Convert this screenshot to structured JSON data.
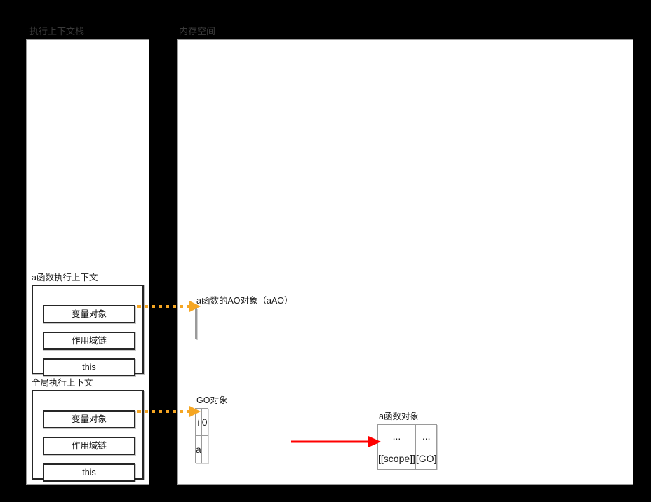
{
  "diagram": {
    "title_left": "执行上下文栈",
    "title_right": "内存空间",
    "colors": {
      "background": "#000000",
      "panel_fill": "#ffffff",
      "panel_border": "#9a9a9a",
      "box_border": "#262626",
      "table_border": "#9a9a9a",
      "arrow_dotted": "#f5a623",
      "arrow_solid": "#ff0000",
      "label_on_black": "#3a3a3a",
      "text": "#1a1a1a"
    }
  },
  "stack": {
    "label": "执行上下文栈",
    "contexts": [
      {
        "title": "a函数执行上下文",
        "rows": [
          "变量对象",
          "作用域链",
          "this"
        ]
      },
      {
        "title": "全局执行上下文",
        "rows": [
          "变量对象",
          "作用域链",
          "this"
        ]
      }
    ]
  },
  "memory": {
    "label": "内存空间",
    "objects": [
      {
        "title": "a函数的AO对象（aAO）",
        "rows": [
          [
            "",
            ""
          ]
        ]
      },
      {
        "title": "GO对象",
        "rows": [
          [
            "i",
            "0"
          ],
          [
            "a",
            ""
          ]
        ]
      },
      {
        "title": "a函数对象",
        "rows": [
          [
            "...",
            "..."
          ],
          [
            "[[scope]]",
            "[GO]"
          ]
        ]
      }
    ]
  },
  "arrows": [
    {
      "name": "a-context-variable-object-to-aAO",
      "style": "dotted",
      "color": "#f5a623",
      "from": "a函数执行上下文 / 变量对象",
      "to": "a函数的AO对象（aAO）"
    },
    {
      "name": "global-context-variable-object-to-GO",
      "style": "dotted",
      "color": "#f5a623",
      "from": "全局执行上下文 / 变量对象",
      "to": "GO对象"
    },
    {
      "name": "GO-a-value-to-function-object",
      "style": "solid",
      "color": "#ff0000",
      "from": "GO对象 / a",
      "to": "a函数对象"
    }
  ]
}
